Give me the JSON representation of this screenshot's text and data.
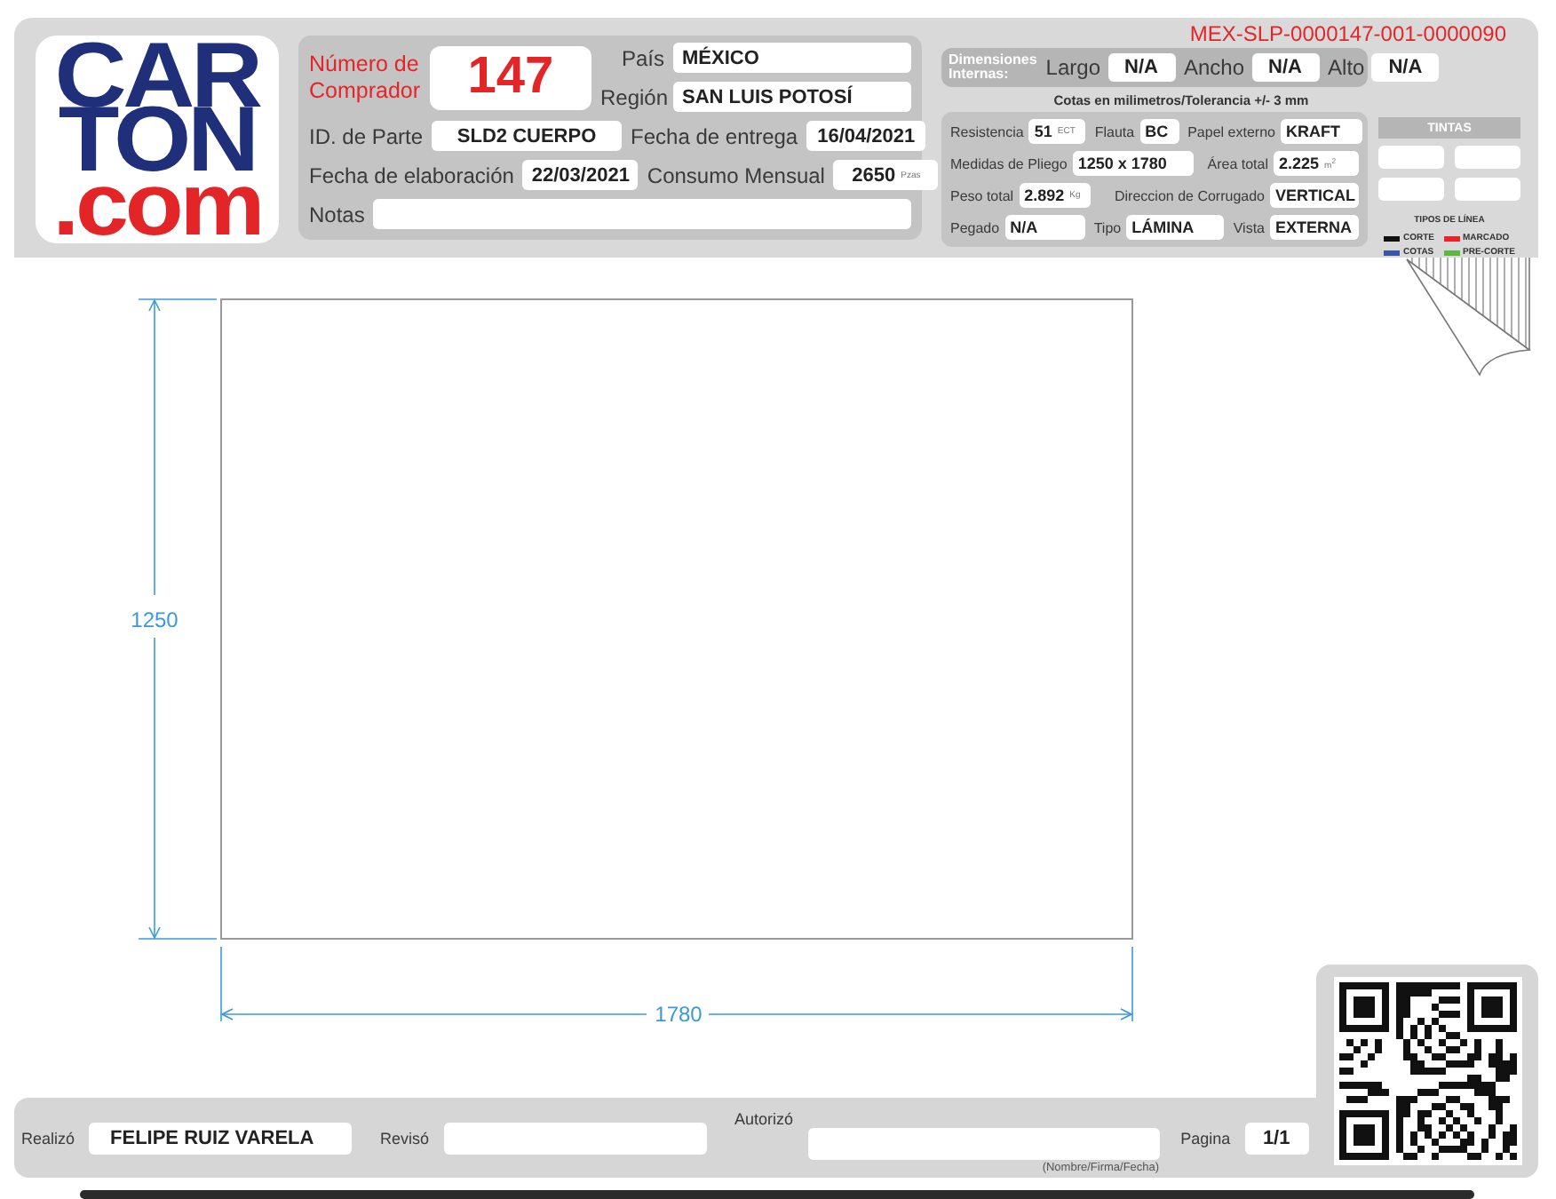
{
  "logo": {
    "lines": [
      {
        "text": "CAR",
        "kind": "brand"
      },
      {
        "text": "TON",
        "kind": "brand"
      },
      {
        "text": ".com",
        "kind": "accent"
      }
    ]
  },
  "buyer": {
    "label": "Número de Comprador",
    "number": "147"
  },
  "location": [
    {
      "label": "País",
      "value": "MÉXICO"
    },
    {
      "label": "Región",
      "value": "SAN LUIS POTOSÍ"
    }
  ],
  "part_rows": [
    [
      {
        "label": "ID. de Parte",
        "value": "SLD2 CUERPO"
      },
      {
        "label": "Fecha de entrega",
        "value": "16/04/2021"
      }
    ],
    [
      {
        "label": "Fecha de elaboración",
        "value": "22/03/2021"
      },
      {
        "label": "Consumo Mensual",
        "value": "2650",
        "unit": "Pzas"
      }
    ]
  ],
  "notes": {
    "label": "Notas"
  },
  "code": "MEX-SLP-0000147-001-0000090",
  "dimensions": {
    "title": "Dimensiones Internas:",
    "items": [
      {
        "label": "Largo",
        "value": "N/A"
      },
      {
        "label": "Ancho",
        "value": "N/A"
      },
      {
        "label": "Alto",
        "value": "N/A"
      }
    ],
    "note": "Cotas en milimetros/Tolerancia +/- 3 mm"
  },
  "specs": [
    [
      {
        "label": "Resistencia",
        "value": "51",
        "unit": "ECT"
      },
      {
        "label": "Flauta",
        "value": "BC"
      },
      {
        "label": "Papel externo",
        "value": "KRAFT"
      }
    ],
    [
      {
        "label": "Medidas de Pliego",
        "value": "1250 x 1780"
      },
      {
        "label": "Área total",
        "value": "2.225",
        "unit": "m$^{2}$"
      }
    ],
    [
      {
        "label": "Peso total",
        "value": "2.892",
        "unit": "Kg"
      },
      {
        "label": "Direccion de Corrugado",
        "value": "VERTICAL"
      }
    ],
    [
      {
        "label": "Pegado",
        "value": "N/A"
      },
      {
        "label": "Tipo",
        "value": "LÁMINA"
      },
      {
        "label": "Vista",
        "value": "EXTERNA"
      }
    ]
  ],
  "inks": {
    "title": "TINTAS"
  },
  "line_types": {
    "title": "TIPOS DE LÍNEA",
    "items": [
      {
        "label": "CORTE",
        "color": "#111111"
      },
      {
        "label": "MARCADO",
        "color": "#e8232a"
      },
      {
        "label": "COTAS",
        "color": "#3b55a8"
      },
      {
        "label": "PRE-CORTE",
        "color": "#5cb83c"
      }
    ]
  },
  "drawing": {
    "height_label": "1250",
    "width_label": "1780"
  },
  "footer": {
    "fields": [
      {
        "label": "Realizó",
        "value": "FELIPE RUIZ VARELA"
      },
      {
        "label": "Revisó"
      },
      {
        "label": "Autorizó",
        "note": "(Nombre/Firma/Fecha)"
      }
    ],
    "page": {
      "label": "Pagina",
      "value": "1/1"
    }
  }
}
